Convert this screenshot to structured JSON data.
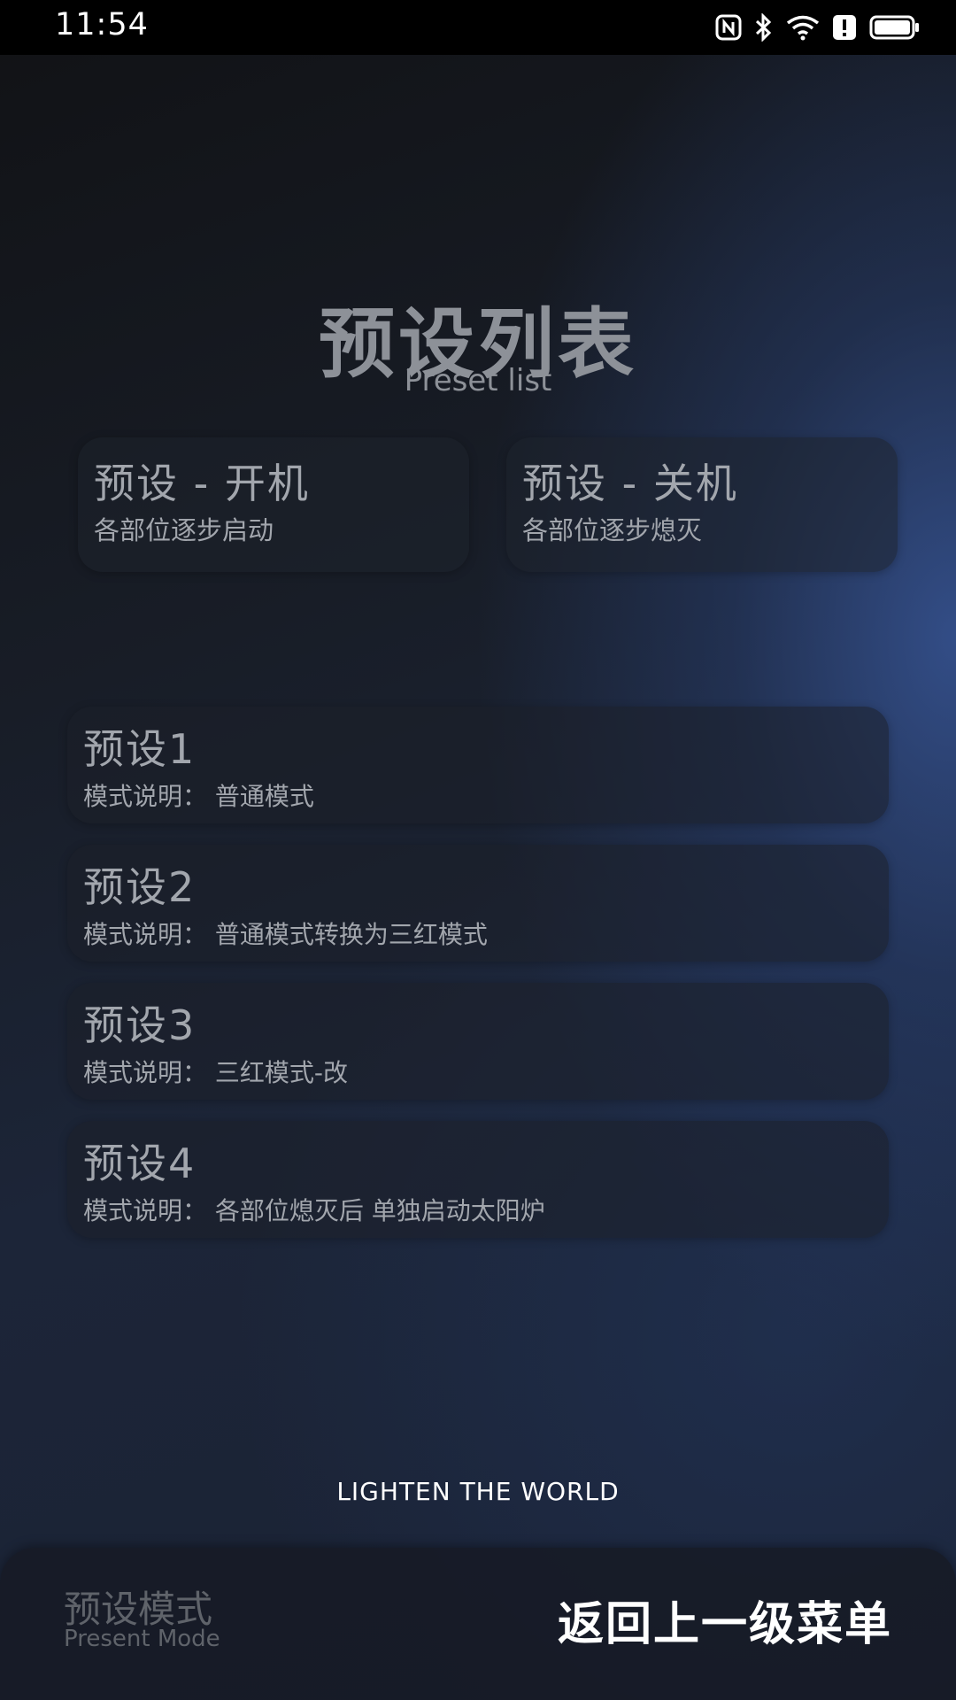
{
  "status_bar": {
    "time": "11:54"
  },
  "header": {
    "title": "预设列表",
    "subtitle": "Preset list"
  },
  "top_cards": [
    {
      "title": "预设 - 开机",
      "description": "各部位逐步启动"
    },
    {
      "title": "预设 - 关机",
      "description": "各部位逐步熄灭"
    }
  ],
  "presets": [
    {
      "title": "预设1",
      "description": "模式说明：  普通模式"
    },
    {
      "title": "预设2",
      "description": "模式说明：  普通模式转换为三红模式"
    },
    {
      "title": "预设3",
      "description": "模式说明：  三红模式-改"
    },
    {
      "title": "预设4",
      "description": "模式说明：  各部位熄灭后 单独启动太阳炉"
    }
  ],
  "slogan": "LIGHTEN THE WORLD",
  "bottom_bar": {
    "mode_title": "预设模式",
    "mode_subtitle": "Present Mode",
    "back_label": "返回上一级菜单"
  },
  "colors": {
    "text_primary": "#a2a6ad",
    "accent_bg": "#1c2538"
  },
  "icons": [
    "nfc-icon",
    "bluetooth-icon",
    "wifi-icon",
    "alert-icon",
    "battery-icon"
  ]
}
